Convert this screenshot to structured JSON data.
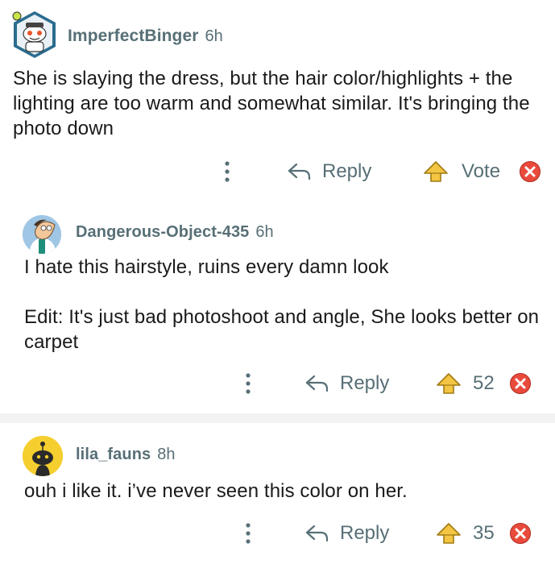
{
  "colors": {
    "meta_text": "#576f76",
    "body_text": "#1a1a1b",
    "upvote_fill": "#f4c542",
    "close_red": "#e84a3c",
    "divider": "#f2f2f3"
  },
  "comments": [
    {
      "username": "ImperfectBinger",
      "age": "6h",
      "avatar_icon": "snoo-avatar-icon",
      "body": [
        "She is slaying the dress, but the hair color/highlights + the lighting are too warm and somewhat similar. It's bringing the photo down"
      ],
      "reply_label": "Reply",
      "vote_label": "Vote"
    },
    {
      "username": "Dangerous-Object-435",
      "age": "6h",
      "avatar_icon": "cartoon-avatar-icon",
      "body": [
        "I hate this hairstyle, ruins every damn look",
        "Edit: It's just bad photoshoot and angle, She looks better on carpet"
      ],
      "reply_label": "Reply",
      "vote_label": "52"
    },
    {
      "username": "lila_fauns",
      "age": "8h",
      "avatar_icon": "yellow-snoo-avatar-icon",
      "body": [
        "ouh i like it. i’ve never seen this color on her."
      ],
      "reply_label": "Reply",
      "vote_label": "35"
    }
  ],
  "icons": {
    "more": "more-vertical-icon",
    "reply": "reply-arrow-icon",
    "upvote": "upvote-icon",
    "close": "close-icon"
  }
}
